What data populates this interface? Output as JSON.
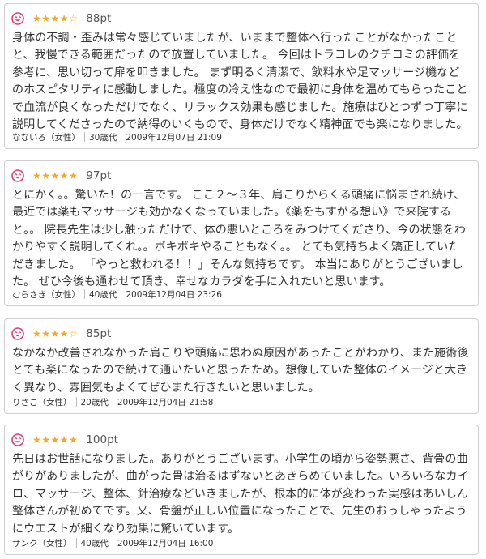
{
  "colors": {
    "accent_pink": "#e4397a",
    "star_gold": "#f5a623",
    "border": "#cfcfcf",
    "text": "#333333"
  },
  "reviews": [
    {
      "icon": "smile-icon",
      "stars": "★★★★☆",
      "star_rating": 4.5,
      "points": "88pt",
      "comment": "身体の不調・歪みは常々感じていましたが、いままで整体へ行ったことがなかったことと、我慢できる範囲だったので放置していました。 今回はトラコレのクチコミの評価を参考に、思い切って扉を叩きました。 まず明るく清潔で、飲料水や足マッサージ機などのホスピタリティに感動しました。極度の冷え性なので最初に身体を温めてもらったことで血流が良くなっただけでなく、リラックス効果も感じました。施療はひとつずつ丁寧に説明してくださったので納得のいくもので、身体だけでなく精神面でも楽になりました。施術後のアドバイスも、勧",
      "name": "なないろ（女性）",
      "age": "30歳代",
      "date": "2009年12月07日 21:09"
    },
    {
      "icon": "smile-icon",
      "stars": "★★★★★",
      "star_rating": 5,
      "points": "97pt",
      "comment": "とにかく。。驚いた！の一言です。 ここ２～３年、肩こりからくる頭痛に悩まされ続け、最近では薬もマッサージも効かなくなっていました。《薬をもすがる想い》で来院すると。。 院長先生は少し触っただけで、体の悪いところをみつけてくださり、今の状態をわかりやすく説明してくれ。。ボキボキやることもなく。。 とても気持ちよく矯正していただきました。 「やっと救われる！！」そんな気持ちです。 本当にありがとうございました。 ぜひ今後も通わせて頂き、幸せなカラダを手に入れたいと思います。",
      "name": "むらさき（女性）",
      "age": "40歳代",
      "date": "2009年12月04日 23:26"
    },
    {
      "icon": "smile-icon",
      "stars": "★★★★☆",
      "star_rating": 4.5,
      "points": "85pt",
      "comment": "なかなか改善されなかった肩こりや頭痛に思わぬ原因があったことがわかり、また施術後とても楽になったので続けて通いたいと思ったため。想像していた整体のイメージと大きく異なり、雰囲気もよくてぜひまた行きたいと思いました。",
      "name": "りさこ（女性）",
      "age": "20歳代",
      "date": "2009年12月04日 21:58"
    },
    {
      "icon": "smile-icon",
      "stars": "★★★★★",
      "star_rating": 5,
      "points": "100pt",
      "comment": "先日はお世話になりました。ありがとうございます。小学生の頃から姿勢悪さ、背骨の曲がりがありましたが、曲がった骨は治るはずないとあきらめていました。いろいろなカイロ、マッサージ、整体、針治療などいきましたが、根本的に体が変わった実感はあいしん整体さんが初めてです。又、骨盤が正しい位置になったことで、先生のおっしゃったようにウエストが細くなり効果に驚いています。",
      "name": "サンク（女性）",
      "age": "40歳代",
      "date": "2009年12月04日 16:00"
    }
  ]
}
